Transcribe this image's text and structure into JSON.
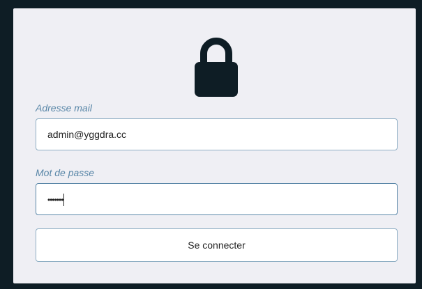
{
  "login": {
    "lock_icon": "lock-icon",
    "email_label": "Adresse mail",
    "email_value": "admin@yggdra.cc",
    "password_label": "Mot de passe",
    "password_value": "•••••••",
    "submit_label": "Se connecter"
  },
  "colors": {
    "background": "#0e1d25",
    "card": "#efeff4",
    "label": "#5a87a8",
    "input_border": "#8eaec4",
    "icon": "#0e1d25"
  }
}
